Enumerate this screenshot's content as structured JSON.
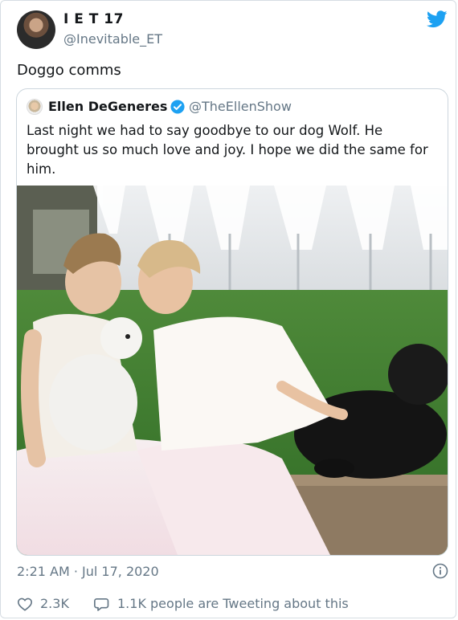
{
  "author": {
    "display_name": "I E T 17",
    "handle": "@Inevitable_ET"
  },
  "tweet_text": "Doggo comms",
  "quoted": {
    "display_name": "Ellen DeGeneres",
    "handle": "@TheEllenShow",
    "text": "Last night we had to say goodbye to our dog Wolf. He brought us so much love and joy. I hope we did the same for him."
  },
  "timestamp": "2:21 AM · Jul 17, 2020",
  "actions": {
    "likes": "2.3K",
    "tweeting": "1.1K people are Tweeting about this"
  },
  "colors": {
    "brand": "#1da1f2",
    "secondary_text": "#657786",
    "border": "#ccd6dd"
  },
  "icons": [
    "twitter-bird-icon",
    "verified-badge-icon",
    "info-icon",
    "heart-icon",
    "reply-bubble-icon"
  ]
}
